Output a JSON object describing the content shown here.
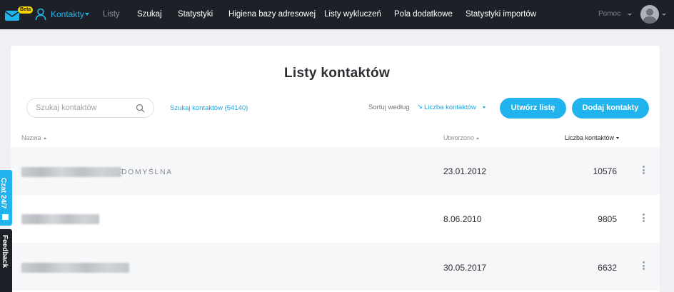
{
  "nav": {
    "beta_badge": "Beta",
    "active_label": "Kontakty",
    "items": [
      "Listy",
      "Szukaj",
      "Statystyki",
      "Higiena bazy adresowej",
      "Listy wykluczeń",
      "Pola dodatkowe",
      "Statystyki importów"
    ],
    "help_label": "Pomoc"
  },
  "page": {
    "title": "Listy kontaktów"
  },
  "toolbar": {
    "search_placeholder": "Szukaj kontaktów",
    "search_link": "Szukaj kontaktów (54140)",
    "sort_label": "Sortuj według",
    "sort_arrow": "↘",
    "sort_value": "Liczba kontaktów",
    "create_list_label": "Utwórz listę",
    "add_contacts_label": "Dodaj kontakty"
  },
  "table": {
    "headers": {
      "name": "Nazwa",
      "created": "Utworzono",
      "count": "Liczba kontaktów"
    },
    "rows": [
      {
        "tag": "DOMYŚLNA",
        "created": "23.01.2012",
        "count": "10576"
      },
      {
        "tag": "",
        "created": "8.06.2010",
        "count": "9805"
      },
      {
        "tag": "",
        "created": "30.05.2017",
        "count": "6632"
      }
    ]
  },
  "side_tabs": {
    "chat": "Czat 24/7",
    "feedback": "Feedback"
  },
  "colors": {
    "accent": "#20b3ed",
    "nav_bg": "#1d2127",
    "beta_badge": "#f3d400"
  }
}
